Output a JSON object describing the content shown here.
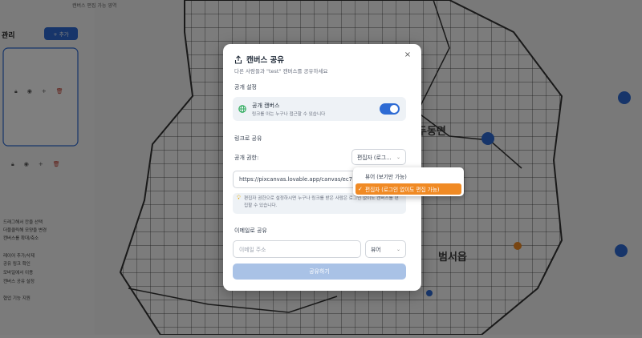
{
  "background": {
    "top_text": "캔버스 편집 가능 영역",
    "left_title": "관리",
    "add_button": "+ 추가",
    "region_labels": [
      "두동면",
      "범서읍"
    ],
    "left_lines": [
      "드래그해서 칸을 선택",
      "더블클릭해 모양을 변경",
      "캔버스를 확대/축소",
      "...",
      "레이어 추가/삭제",
      "공유 링크 확인",
      "모바일에서 이용",
      "캔버스 공유 설정",
      "",
      "협업 기능 지원"
    ]
  },
  "modal": {
    "title": "캔버스 공유",
    "subtitle": "다른 사람들과 \"test\" 캔버스를 공유하세요",
    "close_label": "×",
    "public_settings_label": "공개 설정",
    "public_canvas_title": "공개 캔버스",
    "public_canvas_desc": "링크를 아는 누구나 접근할 수 있습니다",
    "public_toggle_on": true,
    "link_share_label": "링크로 공유",
    "public_permission_label": "공개 권한:",
    "permission_select_value": "편집자 (로그...",
    "link_url": "https://pixcanvas.lovable.app/canvas/ec7",
    "note_text": "편집자 권한으로 설정하시면 누구나 링크를 받은 사람은 로그인 없이도 캔버스를 편집할 수 있습니다.",
    "email_share_label": "이메일로 공유",
    "email_placeholder": "이메일 주소",
    "email_role_value": "뷰어",
    "share_button": "공유하기"
  },
  "dropdown": {
    "options": [
      {
        "label": "뷰어 (보기만 가능)",
        "selected": false
      },
      {
        "label": "편집자 (로그인 없이도 편집 가능)",
        "selected": true
      }
    ]
  },
  "colors": {
    "accent": "#2e6bd4",
    "selected_option": "#f08a24",
    "share_button_disabled": "#a9c2e6"
  }
}
